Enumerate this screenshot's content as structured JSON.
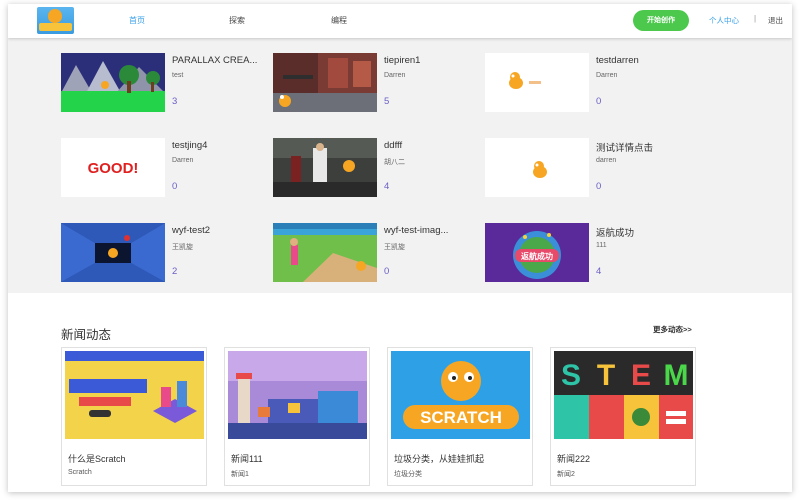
{
  "header": {
    "logo_alt": "Scratch logo",
    "nav": [
      "首页",
      "探索",
      "编程"
    ],
    "start_button": "开始创作",
    "user_center": "个人中心",
    "separator": "|",
    "logout": "退出"
  },
  "projects": [
    {
      "title": "PARALLAX CREA...",
      "author": "test",
      "count": "3"
    },
    {
      "title": "tiepiren1",
      "author": "Darren",
      "count": "5"
    },
    {
      "title": "testdarren",
      "author": "Darren",
      "count": "0"
    },
    {
      "title": "testjing4",
      "author": "Darren",
      "count": "0"
    },
    {
      "title": "ddfff",
      "author": "胡八二",
      "count": "4"
    },
    {
      "title": "测试详情点击",
      "author": "darren",
      "count": "0"
    },
    {
      "title": "wyf-test2",
      "author": "王凯旋",
      "count": "2"
    },
    {
      "title": "wyf-test-imag...",
      "author": "王凯旋",
      "count": "0"
    },
    {
      "title": "返航成功",
      "author": "111",
      "count": "4"
    }
  ],
  "news": {
    "heading": "新闻动态",
    "more": "更多动态>>",
    "items": [
      {
        "title": "什么是Scratch",
        "subtitle": "Scratch"
      },
      {
        "title": "新闻111",
        "subtitle": "新闻1"
      },
      {
        "title": "垃圾分类，从娃娃抓起",
        "subtitle": "垃圾分类"
      },
      {
        "title": "新闻222",
        "subtitle": "新闻2"
      }
    ]
  },
  "thumbnail_texts": {
    "good": "GOOD!",
    "success_badge": "返航成功",
    "scratch_logo": "SCRATCH",
    "stem": [
      "S",
      "T",
      "E",
      "M"
    ]
  }
}
